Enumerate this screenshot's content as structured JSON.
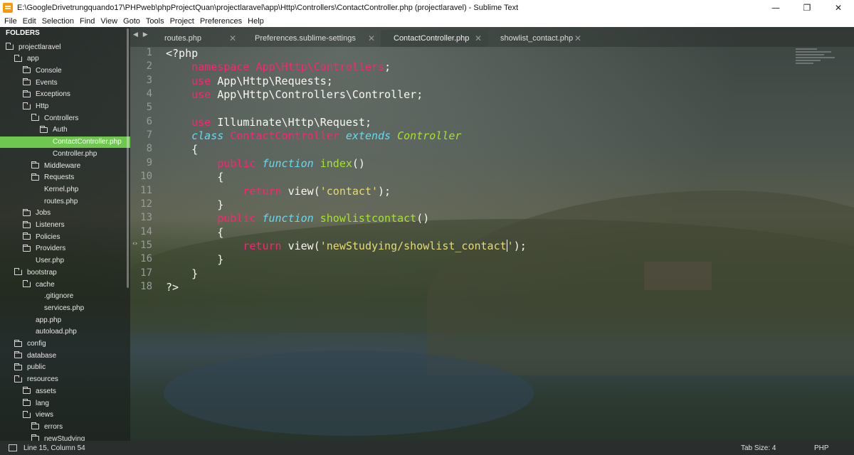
{
  "window": {
    "title": "E:\\GoogleDrivetrungquando17\\PHPweb\\phpProjectQuan\\projectlaravel\\app\\Http\\Controllers\\ContactController.php (projectlaravel) - Sublime Text",
    "minimize_glyph": "—",
    "maximize_glyph": "❐",
    "close_glyph": "✕"
  },
  "menu": [
    "File",
    "Edit",
    "Selection",
    "Find",
    "View",
    "Goto",
    "Tools",
    "Project",
    "Preferences",
    "Help"
  ],
  "sidebar": {
    "header": "FOLDERS",
    "items": [
      {
        "label": "projectlaravel",
        "type": "folder-open"
      },
      {
        "label": "app",
        "type": "folder-open"
      },
      {
        "label": "Console",
        "type": "folder"
      },
      {
        "label": "Events",
        "type": "folder"
      },
      {
        "label": "Exceptions",
        "type": "folder"
      },
      {
        "label": "Http",
        "type": "folder-open"
      },
      {
        "label": "Controllers",
        "type": "folder-open"
      },
      {
        "label": "Auth",
        "type": "folder"
      },
      {
        "label": "ContactController.php",
        "type": "file",
        "active": true
      },
      {
        "label": "Controller.php",
        "type": "file"
      },
      {
        "label": "Middleware",
        "type": "folder"
      },
      {
        "label": "Requests",
        "type": "folder"
      },
      {
        "label": "Kernel.php",
        "type": "file"
      },
      {
        "label": "routes.php",
        "type": "file"
      },
      {
        "label": "Jobs",
        "type": "folder"
      },
      {
        "label": "Listeners",
        "type": "folder"
      },
      {
        "label": "Policies",
        "type": "folder"
      },
      {
        "label": "Providers",
        "type": "folder"
      },
      {
        "label": "User.php",
        "type": "file"
      },
      {
        "label": "bootstrap",
        "type": "folder-open"
      },
      {
        "label": "cache",
        "type": "folder-open"
      },
      {
        "label": ".gitignore",
        "type": "file"
      },
      {
        "label": "services.php",
        "type": "file"
      },
      {
        "label": "app.php",
        "type": "file"
      },
      {
        "label": "autoload.php",
        "type": "file"
      },
      {
        "label": "config",
        "type": "folder"
      },
      {
        "label": "database",
        "type": "folder"
      },
      {
        "label": "public",
        "type": "folder"
      },
      {
        "label": "resources",
        "type": "folder-open"
      },
      {
        "label": "assets",
        "type": "folder"
      },
      {
        "label": "lang",
        "type": "folder"
      },
      {
        "label": "views",
        "type": "folder-open"
      },
      {
        "label": "errors",
        "type": "folder"
      },
      {
        "label": "newStudying",
        "type": "folder"
      }
    ]
  },
  "tabs": [
    {
      "label": "routes.php",
      "active": false
    },
    {
      "label": "Preferences.sublime-settings",
      "active": false
    },
    {
      "label": "ContactController.php",
      "active": true
    },
    {
      "label": "showlist_contact.php",
      "active": false
    }
  ],
  "tab_nav_glyphs": "◀ ▶",
  "tab_close_glyph": "✕",
  "fold_marker": "‹›",
  "code": [
    [
      [
        "tok-plain",
        "<?php"
      ]
    ],
    [
      [
        "tok-plain",
        "    "
      ],
      [
        "tok-kw",
        "namespace"
      ],
      [
        "tok-plain",
        " "
      ],
      [
        "tok-kw",
        "App\\Http\\Controllers"
      ],
      [
        "tok-plain",
        ";"
      ]
    ],
    [
      [
        "tok-plain",
        "    "
      ],
      [
        "tok-kw",
        "use"
      ],
      [
        "tok-plain",
        " App\\Http\\Requests;"
      ]
    ],
    [
      [
        "tok-plain",
        "    "
      ],
      [
        "tok-kw",
        "use"
      ],
      [
        "tok-plain",
        " App\\Http\\Controllers\\Controller;"
      ]
    ],
    [],
    [
      [
        "tok-plain",
        "    "
      ],
      [
        "tok-kw",
        "use"
      ],
      [
        "tok-plain",
        " Illuminate\\Http\\Request;"
      ]
    ],
    [
      [
        "tok-plain",
        "    "
      ],
      [
        "tok-stor",
        "class"
      ],
      [
        "tok-plain",
        " "
      ],
      [
        "tok-kw",
        "ContactController"
      ],
      [
        "tok-plain",
        " "
      ],
      [
        "tok-stor",
        "extends"
      ],
      [
        "tok-plain",
        " "
      ],
      [
        "tok-cls-i",
        "Controller"
      ]
    ],
    [
      [
        "tok-plain",
        "    {"
      ]
    ],
    [
      [
        "tok-plain",
        "        "
      ],
      [
        "tok-kw",
        "public"
      ],
      [
        "tok-plain",
        " "
      ],
      [
        "tok-stor",
        "function"
      ],
      [
        "tok-plain",
        " "
      ],
      [
        "tok-cls",
        "index"
      ],
      [
        "tok-plain",
        "()"
      ]
    ],
    [
      [
        "tok-plain",
        "        {"
      ]
    ],
    [
      [
        "tok-plain",
        "            "
      ],
      [
        "tok-kw",
        "return"
      ],
      [
        "tok-plain",
        " view("
      ],
      [
        "tok-str",
        "'contact'"
      ],
      [
        "tok-plain",
        ");"
      ]
    ],
    [
      [
        "tok-plain",
        "        }"
      ]
    ],
    [
      [
        "tok-plain",
        "        "
      ],
      [
        "tok-kw",
        "public"
      ],
      [
        "tok-plain",
        " "
      ],
      [
        "tok-stor",
        "function"
      ],
      [
        "tok-plain",
        " "
      ],
      [
        "tok-cls",
        "showlistcontact"
      ],
      [
        "tok-plain",
        "()"
      ]
    ],
    [
      [
        "tok-plain",
        "        {"
      ]
    ],
    [
      [
        "tok-plain",
        "            "
      ],
      [
        "tok-kw",
        "return"
      ],
      [
        "tok-plain",
        " view("
      ],
      [
        "tok-str",
        "'newStudying/showlist_contact"
      ],
      [
        "caret",
        ""
      ],
      [
        "tok-str",
        "'"
      ],
      [
        "tok-plain",
        ");"
      ]
    ],
    [
      [
        "tok-plain",
        "        }"
      ]
    ],
    [
      [
        "tok-plain",
        "    }"
      ]
    ],
    [
      [
        "tok-plain",
        "?>"
      ]
    ]
  ],
  "line_numbers": [
    "1",
    "2",
    "3",
    "4",
    "5",
    "6",
    "7",
    "8",
    "9",
    "10",
    "11",
    "12",
    "13",
    "14",
    "15",
    "16",
    "17",
    "18"
  ],
  "status": {
    "position": "Line 15, Column 54",
    "tab_size": "Tab Size: 4",
    "syntax": "PHP"
  }
}
